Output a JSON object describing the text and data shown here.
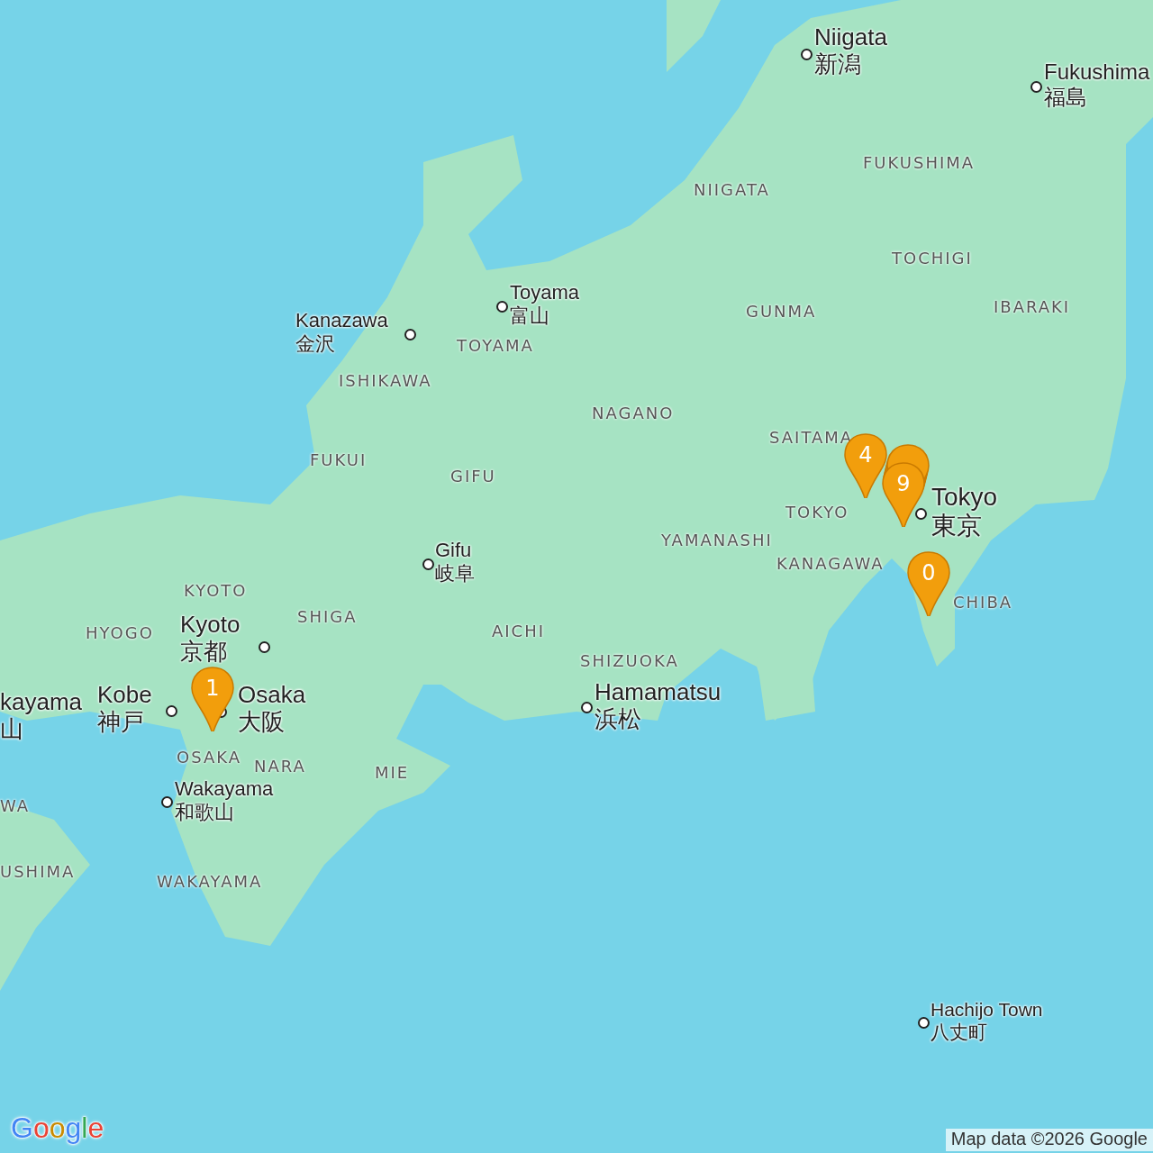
{
  "map": {
    "cities": [
      {
        "name": "Niigata",
        "name_ja": "新潟"
      },
      {
        "name": "Fukushima",
        "name_ja": "福島"
      },
      {
        "name": "Toyama",
        "name_ja": "富山"
      },
      {
        "name": "Kanazawa",
        "name_ja": "金沢"
      },
      {
        "name": "Gifu",
        "name_ja": "岐阜"
      },
      {
        "name": "Kyoto",
        "name_ja": "京都"
      },
      {
        "name": "Kobe",
        "name_ja": "神戸"
      },
      {
        "name": "Osaka",
        "name_ja": "大阪"
      },
      {
        "name": "Wakayama",
        "name_ja": "和歌山"
      },
      {
        "name": "Hamamatsu",
        "name_ja": "浜松"
      },
      {
        "name": "Tokyo",
        "name_ja": "東京"
      },
      {
        "name": "Hachijo Town",
        "name_ja": "八丈町"
      },
      {
        "name": "kayama",
        "name_ja": "山"
      }
    ],
    "regions": [
      "FUKUSHIMA",
      "NIIGATA",
      "TOCHIGI",
      "IBARAKI",
      "GUNMA",
      "TOYAMA",
      "ISHIKAWA",
      "NAGANO",
      "SAITAMA",
      "FUKUI",
      "GIFU",
      "TOKYO",
      "YAMANASHI",
      "KANAGAWA",
      "CHIBA",
      "KYOTO",
      "SHIGA",
      "AICHI",
      "SHIZUOKA",
      "HYOGO",
      "OSAKA",
      "NARA",
      "MIE",
      "WAKAYAMA",
      "USHIMA",
      "WA"
    ],
    "markers": [
      {
        "label": "0"
      },
      {
        "label": "1"
      },
      {
        "label": "4"
      },
      {
        "label": "9"
      }
    ]
  },
  "logo": "Google",
  "attribution": "Map data ©2026 Google"
}
